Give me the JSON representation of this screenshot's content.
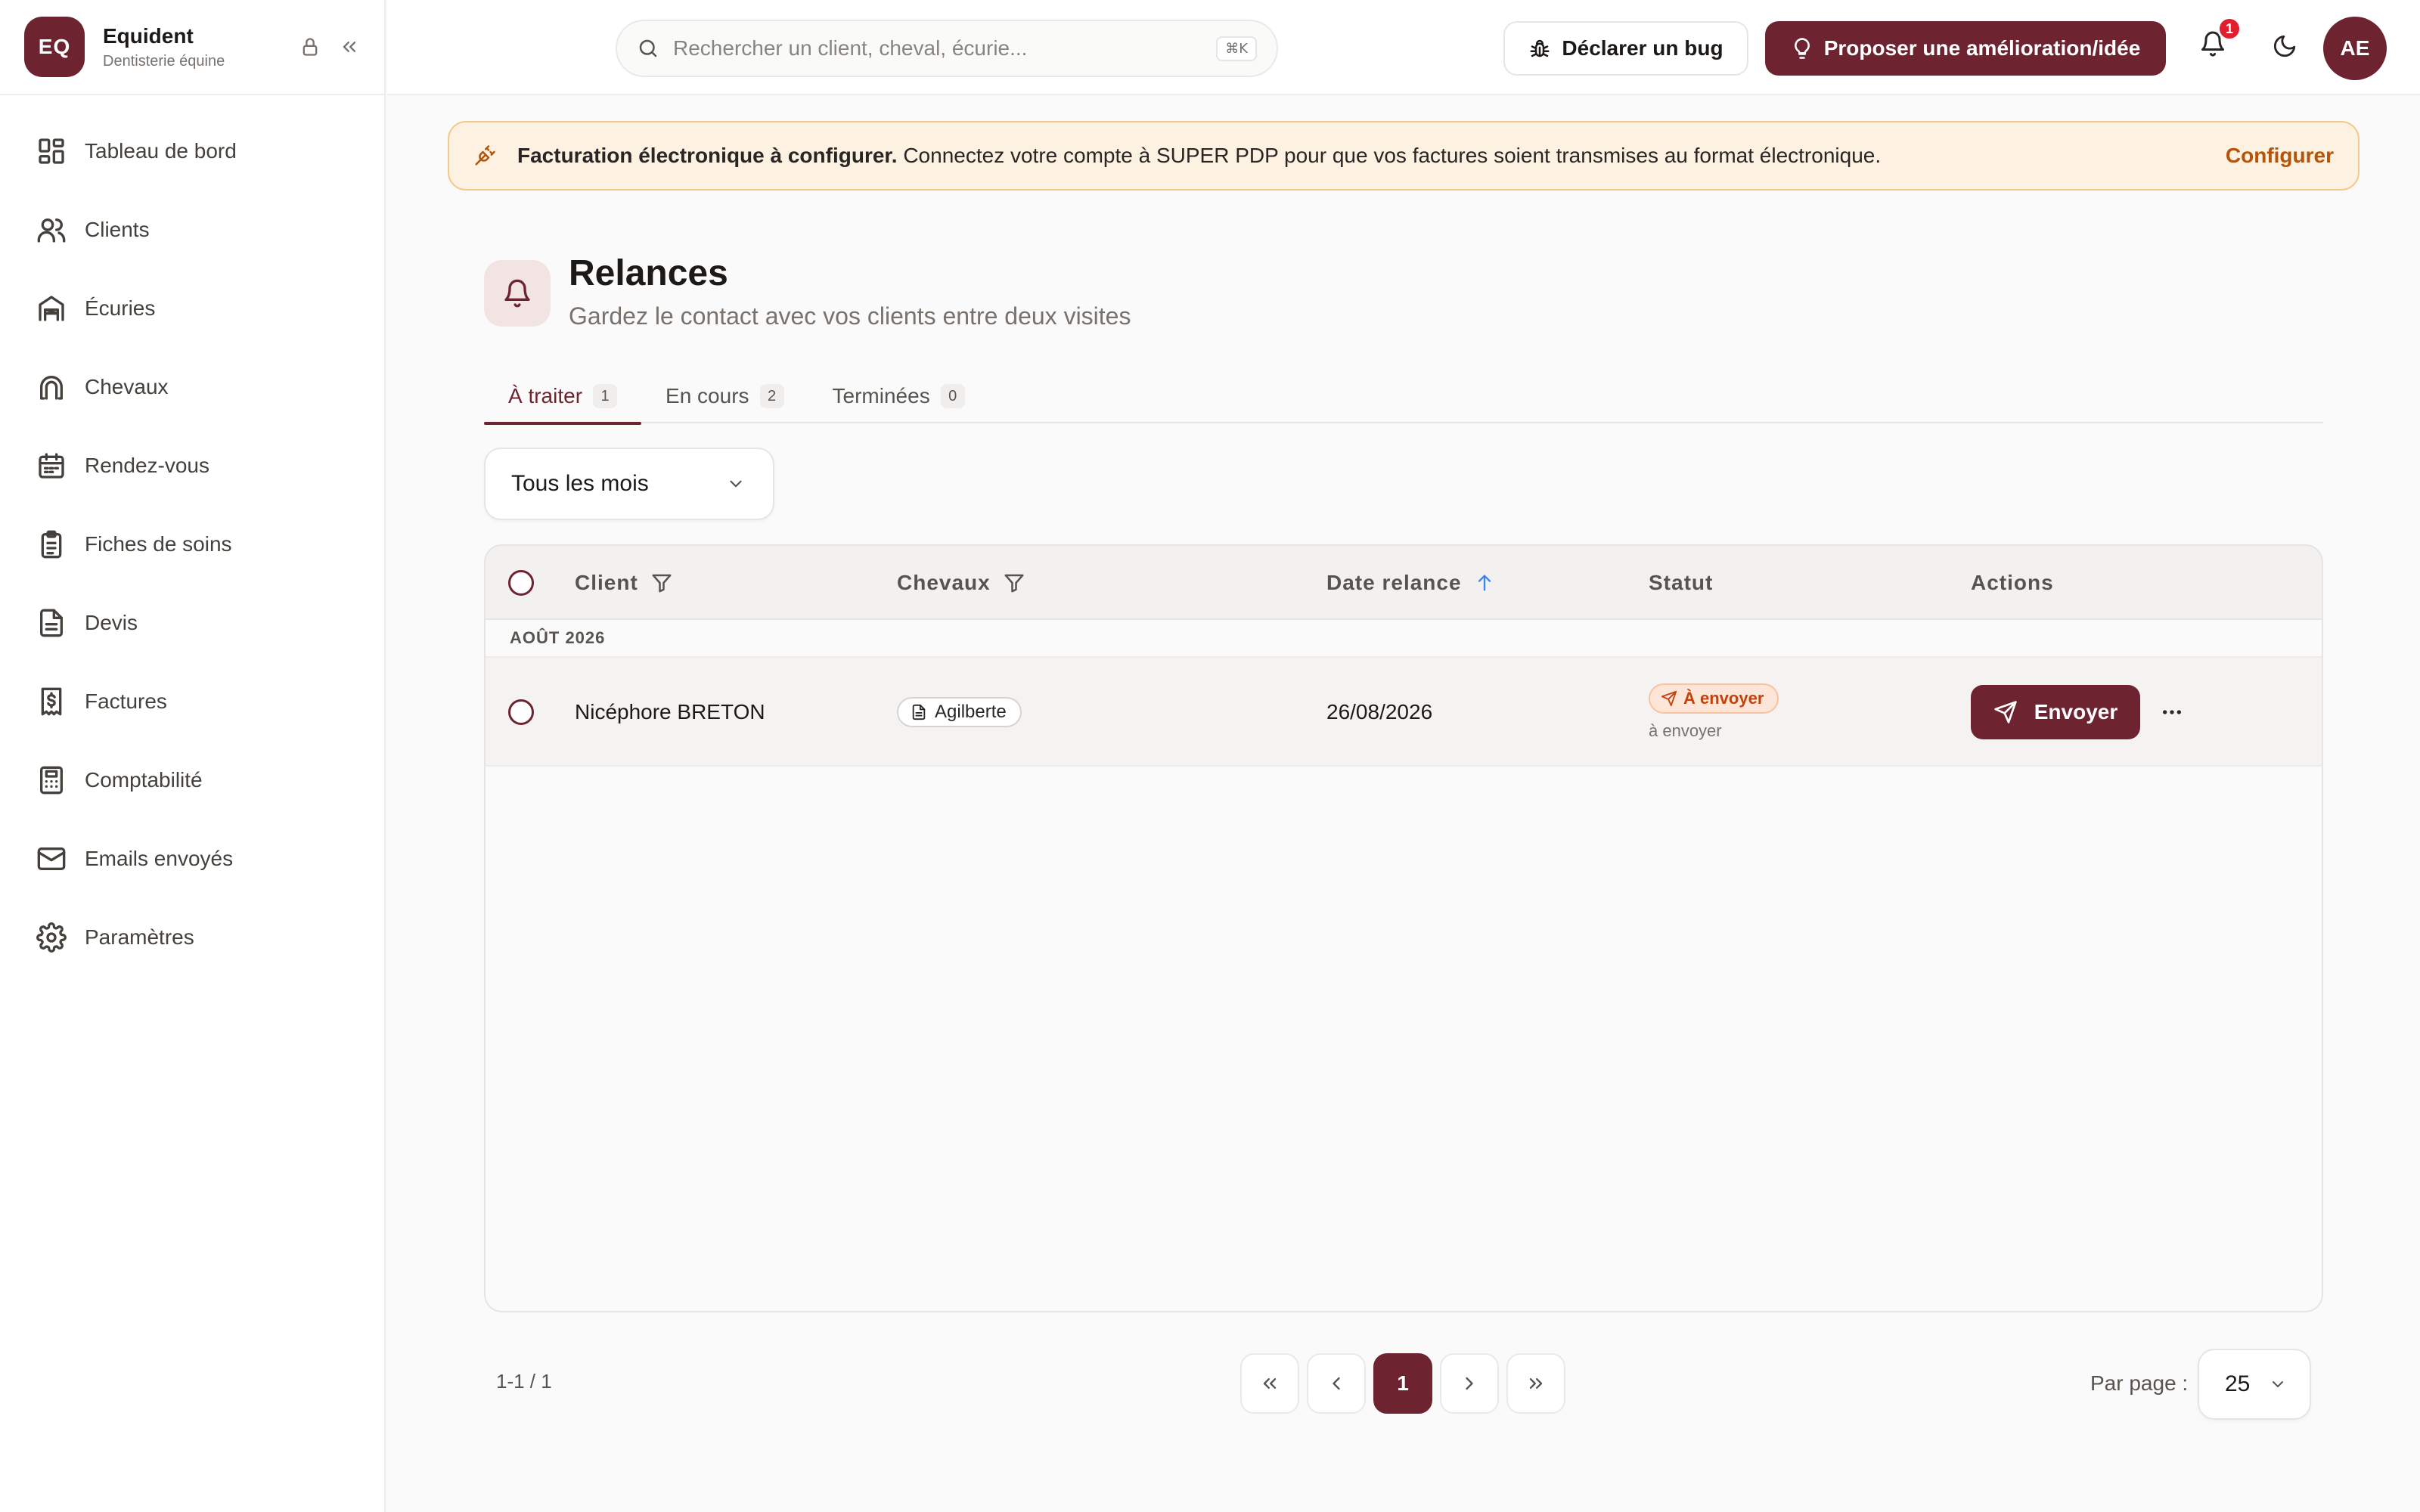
{
  "sidebar": {
    "brand_initials": "EQ",
    "brand_name": "Equident",
    "brand_subtitle": "Dentisterie équine",
    "items": [
      {
        "label": "Tableau de bord",
        "icon": "dashboard-icon"
      },
      {
        "label": "Clients",
        "icon": "users-icon"
      },
      {
        "label": "Écuries",
        "icon": "stable-icon"
      },
      {
        "label": "Chevaux",
        "icon": "horseshoe-icon"
      },
      {
        "label": "Rendez-vous",
        "icon": "calendar-icon"
      },
      {
        "label": "Fiches de soins",
        "icon": "clipboard-icon"
      },
      {
        "label": "Devis",
        "icon": "document-icon"
      },
      {
        "label": "Factures",
        "icon": "invoice-icon"
      },
      {
        "label": "Comptabilité",
        "icon": "calculator-icon"
      },
      {
        "label": "Emails envoyés",
        "icon": "mail-icon"
      },
      {
        "label": "Paramètres",
        "icon": "gear-icon"
      }
    ]
  },
  "header": {
    "search_placeholder": "Rechercher un client, cheval, écurie...",
    "search_shortcut": "⌘K",
    "bug_button": "Déclarer un bug",
    "idea_button": "Proposer une amélioration/idée",
    "notification_count": "1",
    "avatar_initials": "AE"
  },
  "banner": {
    "title": "Facturation électronique à configurer.",
    "message": " Connectez votre compte à SUPER PDP pour que vos factures soient transmises au format électronique.",
    "link": "Configurer"
  },
  "page": {
    "title": "Relances",
    "subtitle": "Gardez le contact avec vos clients entre deux visites"
  },
  "tabs": [
    {
      "label": "À traiter",
      "count": "1"
    },
    {
      "label": "En cours",
      "count": "2"
    },
    {
      "label": "Terminées",
      "count": "0"
    }
  ],
  "filter": {
    "month_value": "Tous les mois"
  },
  "table": {
    "columns": {
      "client": "Client",
      "horses": "Chevaux",
      "date": "Date relance",
      "status": "Statut",
      "actions": "Actions"
    },
    "group_label": "AOÛT 2026",
    "rows": [
      {
        "client": "Nicéphore BRETON",
        "horse": "Agilberte",
        "date": "26/08/2026",
        "status": "À envoyer",
        "status_sub": "à envoyer",
        "action": "Envoyer"
      }
    ]
  },
  "pagination": {
    "range": "1-1 / 1",
    "current_page": "1",
    "per_page_label": "Par page :",
    "per_page_value": "25"
  },
  "colors": {
    "brand": "#6e2430",
    "warning": "#b45309",
    "status_orange": "#c2410c",
    "sort_arrow": "#3b82f6"
  }
}
